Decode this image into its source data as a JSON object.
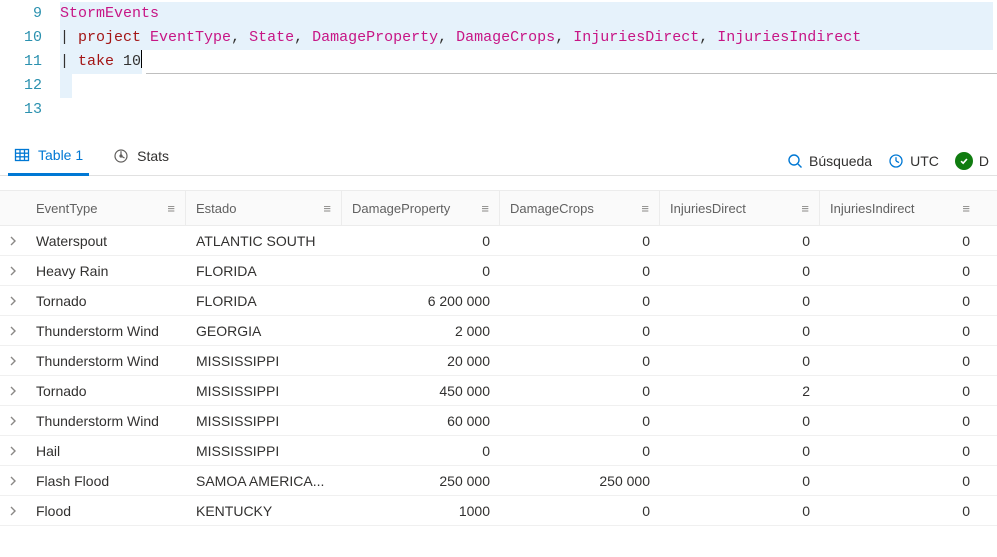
{
  "editor": {
    "lines": [
      {
        "num": "9"
      },
      {
        "num": "10"
      },
      {
        "num": "11"
      },
      {
        "num": "12"
      },
      {
        "num": "13"
      }
    ],
    "tokens": {
      "storm": "StormEvents",
      "pipe1": "| ",
      "project": "project",
      "sp": " ",
      "c1": "EventType",
      "c2": "State",
      "c3": "DamageProperty",
      "c4": "DamageCrops",
      "c5": "InjuriesDirect",
      "c6": "InjuriesIndirect",
      "comma": ", ",
      "pipe2": "| ",
      "take": "take",
      "n10": "10"
    }
  },
  "tabbar": {
    "table_label": "Table 1",
    "stats_label": "Stats",
    "search_label": "Búsqueda",
    "utc_label": "UTC",
    "status_initial": "D"
  },
  "columns": {
    "c0": "EventType",
    "c1": "Estado",
    "c2": "DamageProperty",
    "c3": "DamageCrops",
    "c4": "InjuriesDirect",
    "c5": "InjuriesIndirect"
  },
  "rows": [
    {
      "event": "Waterspout",
      "state": "ATLANTIC SOUTH",
      "dp": "0",
      "dc": "0",
      "id": "0",
      "ii": "0"
    },
    {
      "event": "Heavy Rain",
      "state": "FLORIDA",
      "dp": "0",
      "dc": "0",
      "id": "0",
      "ii": "0"
    },
    {
      "event": "Tornado",
      "state": "FLORIDA",
      "dp": "6 200 000",
      "dc": "0",
      "id": "0",
      "ii": "0"
    },
    {
      "event": "Thunderstorm Wind",
      "state": "GEORGIA",
      "dp": "2 000",
      "dc": "0",
      "id": "0",
      "ii": "0"
    },
    {
      "event": "Thunderstorm Wind",
      "state": "MISSISSIPPI",
      "dp": "20 000",
      "dc": "0",
      "id": "0",
      "ii": "0"
    },
    {
      "event": "Tornado",
      "state": "MISSISSIPPI",
      "dp": "450 000",
      "dc": "0",
      "id": "2",
      "ii": "0"
    },
    {
      "event": "Thunderstorm Wind",
      "state": "MISSISSIPPI",
      "dp": "60 000",
      "dc": "0",
      "id": "0",
      "ii": "0"
    },
    {
      "event": "Hail",
      "state": "MISSISSIPPI",
      "dp": "0",
      "dc": "0",
      "id": "0",
      "ii": "0"
    },
    {
      "event": "Flash Flood",
      "state": "SAMOA AMERICA...",
      "dp": "250 000",
      "dc": "250 000",
      "id": "0",
      "ii": "0"
    },
    {
      "event": "Flood",
      "state": "KENTUCKY",
      "dp": "1000",
      "dc": "0",
      "id": "0",
      "ii": "0"
    }
  ],
  "chart_data": {
    "type": "table",
    "columns": [
      "EventType",
      "State",
      "DamageProperty",
      "DamageCrops",
      "InjuriesDirect",
      "InjuriesIndirect"
    ],
    "rows": [
      [
        "Waterspout",
        "ATLANTIC SOUTH",
        0,
        0,
        0,
        0
      ],
      [
        "Heavy Rain",
        "FLORIDA",
        0,
        0,
        0,
        0
      ],
      [
        "Tornado",
        "FLORIDA",
        6200000,
        0,
        0,
        0
      ],
      [
        "Thunderstorm Wind",
        "GEORGIA",
        2000,
        0,
        0,
        0
      ],
      [
        "Thunderstorm Wind",
        "MISSISSIPPI",
        20000,
        0,
        0,
        0
      ],
      [
        "Tornado",
        "MISSISSIPPI",
        450000,
        0,
        2,
        0
      ],
      [
        "Thunderstorm Wind",
        "MISSISSIPPI",
        60000,
        0,
        0,
        0
      ],
      [
        "Hail",
        "MISSISSIPPI",
        0,
        0,
        0,
        0
      ],
      [
        "Flash Flood",
        "SAMOA AMERICA...",
        250000,
        250000,
        0,
        0
      ],
      [
        "Flood",
        "KENTUCKY",
        1000,
        0,
        0,
        0
      ]
    ]
  }
}
